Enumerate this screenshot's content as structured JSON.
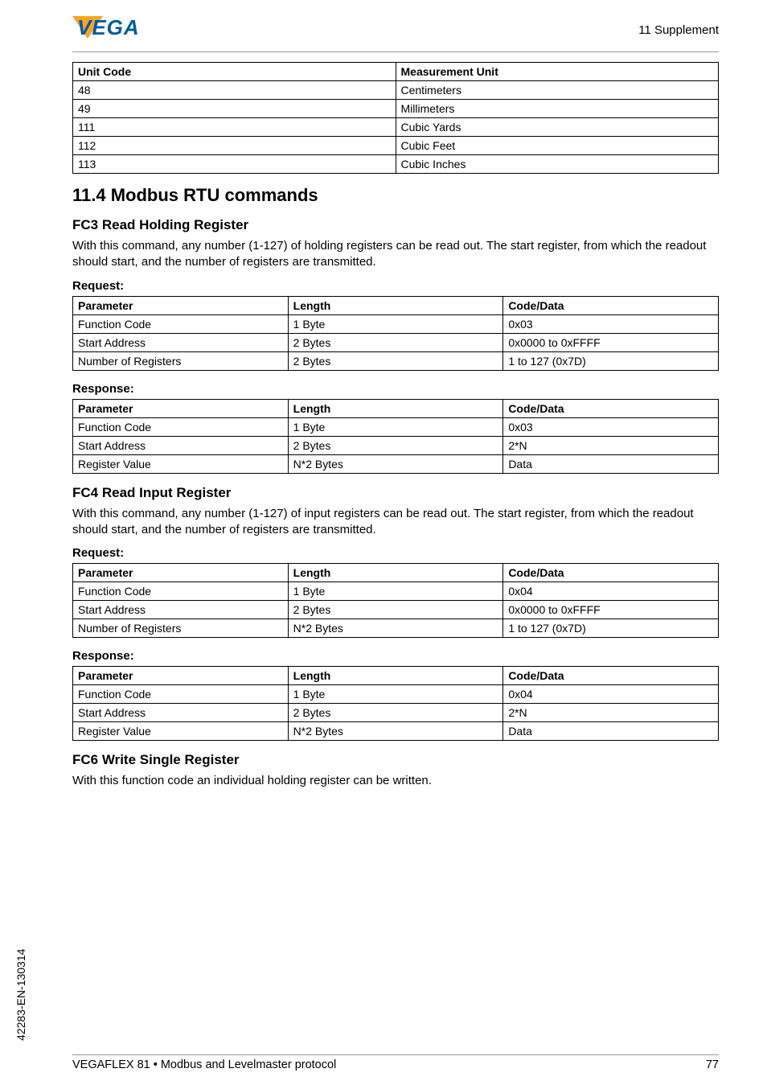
{
  "header": {
    "supplement": "11 Supplement"
  },
  "unit_table": {
    "headers": [
      "Unit Code",
      "Measurement Unit"
    ],
    "rows": [
      [
        "48",
        "Centimeters"
      ],
      [
        "49",
        "Millimeters"
      ],
      [
        "111",
        "Cubic Yards"
      ],
      [
        "112",
        "Cubic Feet"
      ],
      [
        "113",
        "Cubic Inches"
      ]
    ]
  },
  "section_title": "11.4   Modbus RTU commands",
  "fc3": {
    "title": "FC3 Read Holding Register",
    "desc": "With this command, any number (1-127) of holding registers can be read out. The start register, from which the readout should start, and the number of registers are transmitted.",
    "request_label": "Request:",
    "request_headers": [
      "Parameter",
      "Length",
      "Code/Data"
    ],
    "request_rows": [
      [
        "Function Code",
        "1 Byte",
        "0x03"
      ],
      [
        "Start Address",
        "2 Bytes",
        "0x0000 to 0xFFFF"
      ],
      [
        "Number of Registers",
        "2 Bytes",
        "1 to 127 (0x7D)"
      ]
    ],
    "response_label": "Response:",
    "response_headers": [
      "Parameter",
      "Length",
      "Code/Data"
    ],
    "response_rows": [
      [
        "Function Code",
        "1 Byte",
        "0x03"
      ],
      [
        "Start Address",
        "2 Bytes",
        "2*N"
      ],
      [
        "Register Value",
        "N*2 Bytes",
        "Data"
      ]
    ]
  },
  "fc4": {
    "title": "FC4 Read Input Register",
    "desc": "With this command, any number (1-127) of input registers can be read out. The start register, from which the readout should start, and the number of registers are transmitted.",
    "request_label": "Request:",
    "request_headers": [
      "Parameter",
      "Length",
      "Code/Data"
    ],
    "request_rows": [
      [
        "Function Code",
        "1 Byte",
        "0x04"
      ],
      [
        "Start Address",
        "2 Bytes",
        "0x0000 to 0xFFFF"
      ],
      [
        "Number of Registers",
        "N*2 Bytes",
        "1 to 127 (0x7D)"
      ]
    ],
    "response_label": "Response:",
    "response_headers": [
      "Parameter",
      "Length",
      "Code/Data"
    ],
    "response_rows": [
      [
        "Function Code",
        "1 Byte",
        "0x04"
      ],
      [
        "Start Address",
        "2 Bytes",
        "2*N"
      ],
      [
        "Register Value",
        "N*2 Bytes",
        "Data"
      ]
    ]
  },
  "fc6": {
    "title": "FC6 Write Single Register",
    "desc": "With this function code an individual holding register can be written."
  },
  "side_text": "42283-EN-130314",
  "footer": {
    "left": "VEGAFLEX 81 • Modbus and Levelmaster protocol",
    "right": "77"
  }
}
